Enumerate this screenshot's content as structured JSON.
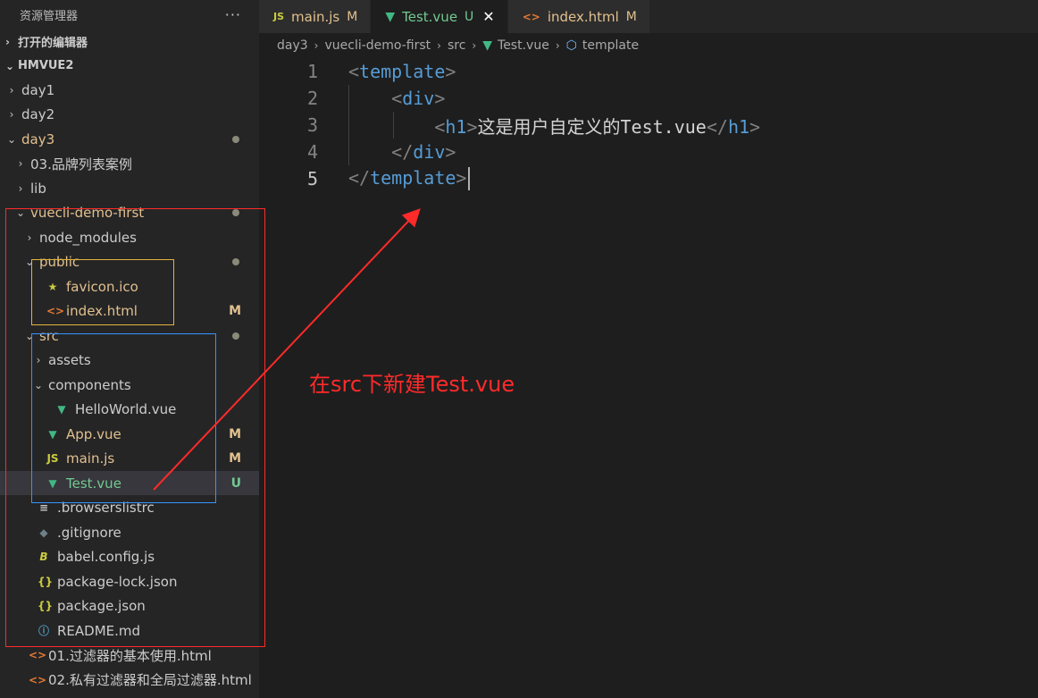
{
  "explorer": {
    "title": "资源管理器",
    "more": "···",
    "open_editors": "打开的编辑器",
    "workspace": "HMVUE2",
    "items": [
      {
        "label": "day1",
        "type": "folder",
        "open": false,
        "depth": 0,
        "color": "plain"
      },
      {
        "label": "day2",
        "type": "folder",
        "open": false,
        "depth": 0,
        "color": "plain"
      },
      {
        "label": "day3",
        "type": "folder",
        "open": true,
        "depth": 0,
        "color": "modified",
        "dot": true
      },
      {
        "label": "03.品牌列表案例",
        "type": "folder",
        "open": false,
        "depth": 1,
        "color": "plain"
      },
      {
        "label": "lib",
        "type": "folder",
        "open": false,
        "depth": 1,
        "color": "plain"
      },
      {
        "label": "vuecli-demo-first",
        "type": "folder",
        "open": true,
        "depth": 1,
        "color": "modified",
        "dot": true
      },
      {
        "label": "node_modules",
        "type": "folder",
        "open": false,
        "depth": 2,
        "color": "plain"
      },
      {
        "label": "public",
        "type": "folder",
        "open": true,
        "depth": 2,
        "color": "modified",
        "dot": true
      },
      {
        "label": "favicon.ico",
        "type": "file",
        "icon": "star",
        "depth": 3,
        "color": "modified"
      },
      {
        "label": "index.html",
        "type": "file",
        "icon": "html",
        "depth": 3,
        "color": "modified",
        "badge": "M"
      },
      {
        "label": "src",
        "type": "folder",
        "open": true,
        "depth": 2,
        "color": "modified",
        "dot": true
      },
      {
        "label": "assets",
        "type": "folder",
        "open": false,
        "depth": 3,
        "color": "plain"
      },
      {
        "label": "components",
        "type": "folder",
        "open": true,
        "depth": 3,
        "color": "plain"
      },
      {
        "label": "HelloWorld.vue",
        "type": "file",
        "icon": "vue",
        "depth": 4,
        "color": "plain"
      },
      {
        "label": "App.vue",
        "type": "file",
        "icon": "vue",
        "depth": 3,
        "color": "modified",
        "badge": "M"
      },
      {
        "label": "main.js",
        "type": "file",
        "icon": "js",
        "depth": 3,
        "color": "modified",
        "badge": "M"
      },
      {
        "label": "Test.vue",
        "type": "file",
        "icon": "vue",
        "depth": 3,
        "color": "untracked",
        "badge": "U",
        "selected": true
      },
      {
        "label": ".browserslistrc",
        "type": "file",
        "icon": "lines",
        "depth": 2,
        "color": "plain"
      },
      {
        "label": ".gitignore",
        "type": "file",
        "icon": "git",
        "depth": 2,
        "color": "plain"
      },
      {
        "label": "babel.config.js",
        "type": "file",
        "icon": "babel",
        "depth": 2,
        "color": "plain"
      },
      {
        "label": "package-lock.json",
        "type": "file",
        "icon": "json",
        "depth": 2,
        "color": "plain"
      },
      {
        "label": "package.json",
        "type": "file",
        "icon": "json",
        "depth": 2,
        "color": "plain"
      },
      {
        "label": "README.md",
        "type": "file",
        "icon": "info",
        "depth": 2,
        "color": "plain"
      },
      {
        "label": "01.过滤器的基本使用.html",
        "type": "file",
        "icon": "html",
        "depth": 1,
        "color": "plain"
      },
      {
        "label": "02.私有过滤器和全局过滤器.html",
        "type": "file",
        "icon": "html",
        "depth": 1,
        "color": "plain"
      }
    ]
  },
  "tabs": [
    {
      "icon": "js",
      "label": "main.js",
      "badge": "M",
      "color": "modified",
      "active": false
    },
    {
      "icon": "vue",
      "label": "Test.vue",
      "badge": "U",
      "color": "untracked",
      "active": true,
      "close": "✕"
    },
    {
      "icon": "html",
      "label": "index.html",
      "badge": "M",
      "color": "modified",
      "active": false
    }
  ],
  "breadcrumb": {
    "parts": [
      "day3",
      "vuecli-demo-first",
      "src"
    ],
    "file": "Test.vue",
    "symbol": "template"
  },
  "editor": {
    "lines": [
      {
        "num": "1",
        "indent": "",
        "open": "<",
        "tag": "template",
        "close": ">",
        "text": "",
        "tag2": ""
      },
      {
        "num": "2",
        "indent": "    ",
        "open": "<",
        "tag": "div",
        "close": ">",
        "text": "",
        "tag2": ""
      },
      {
        "num": "3",
        "indent": "        ",
        "open": "<",
        "tag": "h1",
        "close": ">",
        "text": "这是用户自定义的Test.vue",
        "tag2": "h1"
      },
      {
        "num": "4",
        "indent": "    ",
        "open": "</",
        "tag": "div",
        "close": ">",
        "text": "",
        "tag2": ""
      },
      {
        "num": "5",
        "indent": "",
        "open": "</",
        "tag": "template",
        "close": ">",
        "text": "",
        "tag2": ""
      }
    ],
    "current_line": 5
  },
  "annotation": "在src下新建Test.vue",
  "colors": {
    "red_box": "#ff2a2a",
    "yellow_box": "#e2b43a",
    "blue_box": "#3794ff",
    "arrow": "#ff2a2a"
  }
}
